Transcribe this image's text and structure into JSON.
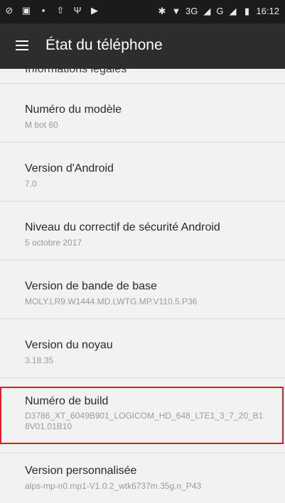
{
  "status_bar": {
    "icons_left": [
      "block-icon",
      "image-icon",
      "image-icon",
      "upload-icon",
      "usb-icon",
      "play-icon"
    ],
    "icons_right": [
      "bluetooth-icon",
      "wifi-icon"
    ],
    "network_text": "3G",
    "network_text_2": "G",
    "time": "16:12"
  },
  "app_bar": {
    "menu_icon": "menu-icon",
    "title": "État du téléphone"
  },
  "list": {
    "partial_label": "Informations légales",
    "items": [
      {
        "label": "Numéro du modèle",
        "value": "M bot 60"
      },
      {
        "label": "Version d'Android",
        "value": "7.0"
      },
      {
        "label": "Niveau du correctif de sécurité Android",
        "value": "5 octobre 2017"
      },
      {
        "label": "Version de bande de base",
        "value": "MOLY.LR9.W1444.MD.LWTG.MP.V110.5.P36"
      },
      {
        "label": "Version du noyau",
        "value": "3.18.35"
      },
      {
        "label": "Numéro de build",
        "value": "D3786_XT_6049B901_LOGICOM_HD_648_LTE1_3_7_20_B18V01.01B10"
      },
      {
        "label": "Version personnalisée",
        "value": "alps-mp-n0.mp1-V1.0.2_wtk6737m.35g.n_P43"
      }
    ]
  },
  "colors": {
    "status_bar_bg": "#1b1b1b",
    "app_bar_bg": "#2d2d2d",
    "list_bg": "#f2f2f2",
    "highlight_border": "#e31b23"
  }
}
